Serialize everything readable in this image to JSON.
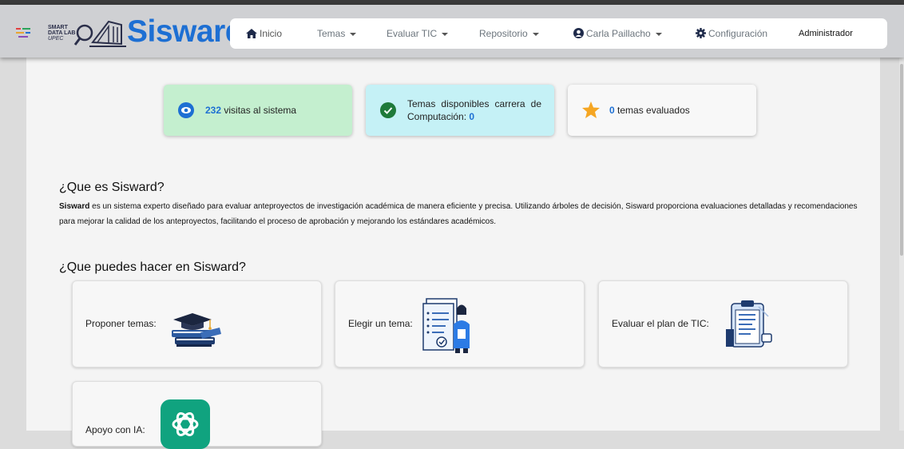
{
  "brand": {
    "logo_small_lines": [
      "SMART",
      "DATA LAB",
      "UPEC"
    ],
    "name": "Sisward",
    "accent": "#1d6fd3"
  },
  "nav": {
    "inicio": "Inicio",
    "temas": "Temas",
    "evaluar": "Evaluar TIC",
    "repositorio": "Repositorio",
    "user": "Carla Paillacho",
    "config": "Configuración",
    "role": "Administrador"
  },
  "stats": {
    "visits": {
      "count": "232",
      "label": "visitas al sistema",
      "bg": "#c4efcf"
    },
    "temas": {
      "label": "Temas disponibles carrera de Computación:",
      "count": "0",
      "bg": "#c5f1f6"
    },
    "evaluados": {
      "count": "0",
      "label": "temas evaluados",
      "bg": "#f8f8f8"
    }
  },
  "about": {
    "title": "¿Que es Sisward?",
    "strong": "Sisward",
    "body": "es un sistema experto diseñado para evaluar anteproyectos de investigación académica de manera eficiente y precisa. Utilizando árboles de decisión, Sisward proporciona evaluaciones detalladas y recomendaciones para mejorar la calidad de los anteproyectos, facilitando el proceso de aprobación y mejorando los estándares académicos."
  },
  "actions": {
    "title": "¿Que puedes hacer en Sisward?",
    "cards": [
      {
        "label": "Proponer temas:",
        "icon": "graduation-books-icon"
      },
      {
        "label": "Elegir un tema:",
        "icon": "document-person-icon"
      },
      {
        "label": "Evaluar el plan de TIC:",
        "icon": "clipboard-icon"
      },
      {
        "label": "Apoyo con IA:",
        "icon": "openai-icon"
      }
    ]
  }
}
